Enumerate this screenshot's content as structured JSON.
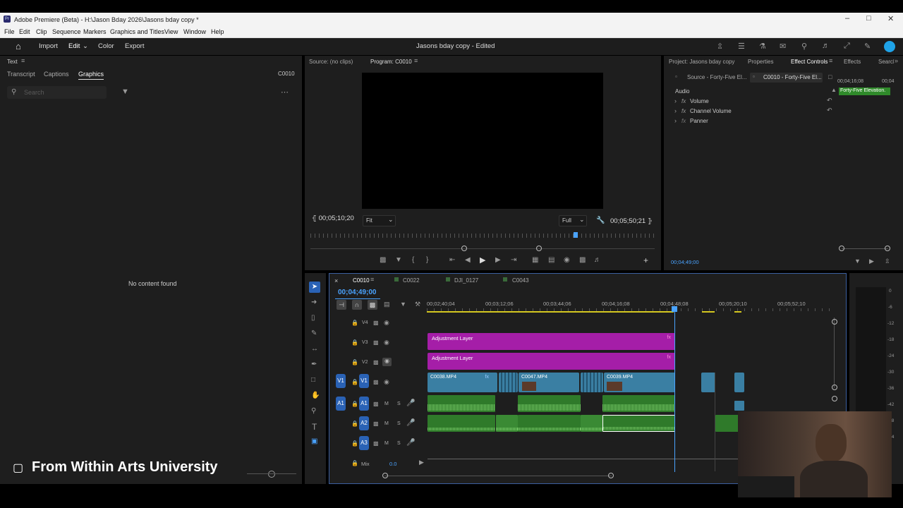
{
  "app": {
    "title": "Adobe Premiere (Beta) - H:\\Jason Bday 2026\\Jasons bday copy *",
    "logo": "Pr"
  },
  "menu": [
    "File",
    "Edit",
    "Clip",
    "Sequence",
    "Markers",
    "Graphics and Titles",
    "View",
    "Window",
    "Help"
  ],
  "header": {
    "tabs": [
      "Import",
      "Edit",
      "Color",
      "Export"
    ],
    "project_title": "Jasons bday copy - Edited"
  },
  "left_panel": {
    "title": "Text",
    "tabs": [
      "Transcript",
      "Captions",
      "Graphics"
    ],
    "clip": "C0010",
    "search_placeholder": "Search",
    "empty": "No content found",
    "footer_brand": "From Within Arts University"
  },
  "monitor": {
    "source_tab": "Source: (no clips)",
    "program_tab": "Program: C0010",
    "timecode_left": "00;05;10;20",
    "fit": "Fit",
    "quality": "Full",
    "timecode_right": "00;05;50;21"
  },
  "right_panel": {
    "tabs": [
      "Project: Jasons bday copy",
      "Properties",
      "Effect Controls",
      "Effects",
      "Search"
    ],
    "sub_tabs": [
      "Source - Forty-Five El...",
      "C0010 - Forty-Five El..."
    ],
    "section": "Audio",
    "effects": [
      "Volume",
      "Channel Volume",
      "Panner"
    ],
    "mini_timecodes": [
      "00;04;16;08",
      "00;04"
    ],
    "mini_clip": "Forty-Five Elevation.",
    "timecode": "00;04;49;00"
  },
  "timeline": {
    "tabs": [
      "C0010",
      "C0022",
      "DJI_0127",
      "C0043"
    ],
    "timecode": "00;04;49;00",
    "ruler": [
      "00;02;40;04",
      "00;03;12;06",
      "00;03;44;06",
      "00;04;16;08",
      "00;04;48;08",
      "00;05;20;10",
      "00;05;52;10"
    ],
    "video_tracks": [
      "V4",
      "V3",
      "V2",
      "V1"
    ],
    "audio_tracks": [
      "A1",
      "A2",
      "A3"
    ],
    "mix_label": "Mix",
    "mix_value": "0.0",
    "adjustment_label": "Adjustment Layer",
    "clip_names": [
      "C0038.MP4",
      "C0047.MP4",
      "C0039.MP4"
    ],
    "meter_scale": [
      "0",
      "-6",
      "-12",
      "-18",
      "-24",
      "-30",
      "-36",
      "-42",
      "-48",
      "-54"
    ],
    "track_btn_m": "M",
    "track_btn_s": "S"
  },
  "colors": {
    "purple": "#a51ea8",
    "video_clip": "#3a7fa3",
    "audio_clip": "#2f7a2a",
    "accent_blue": "#2a62b5",
    "playhead": "#4aa3ff"
  }
}
